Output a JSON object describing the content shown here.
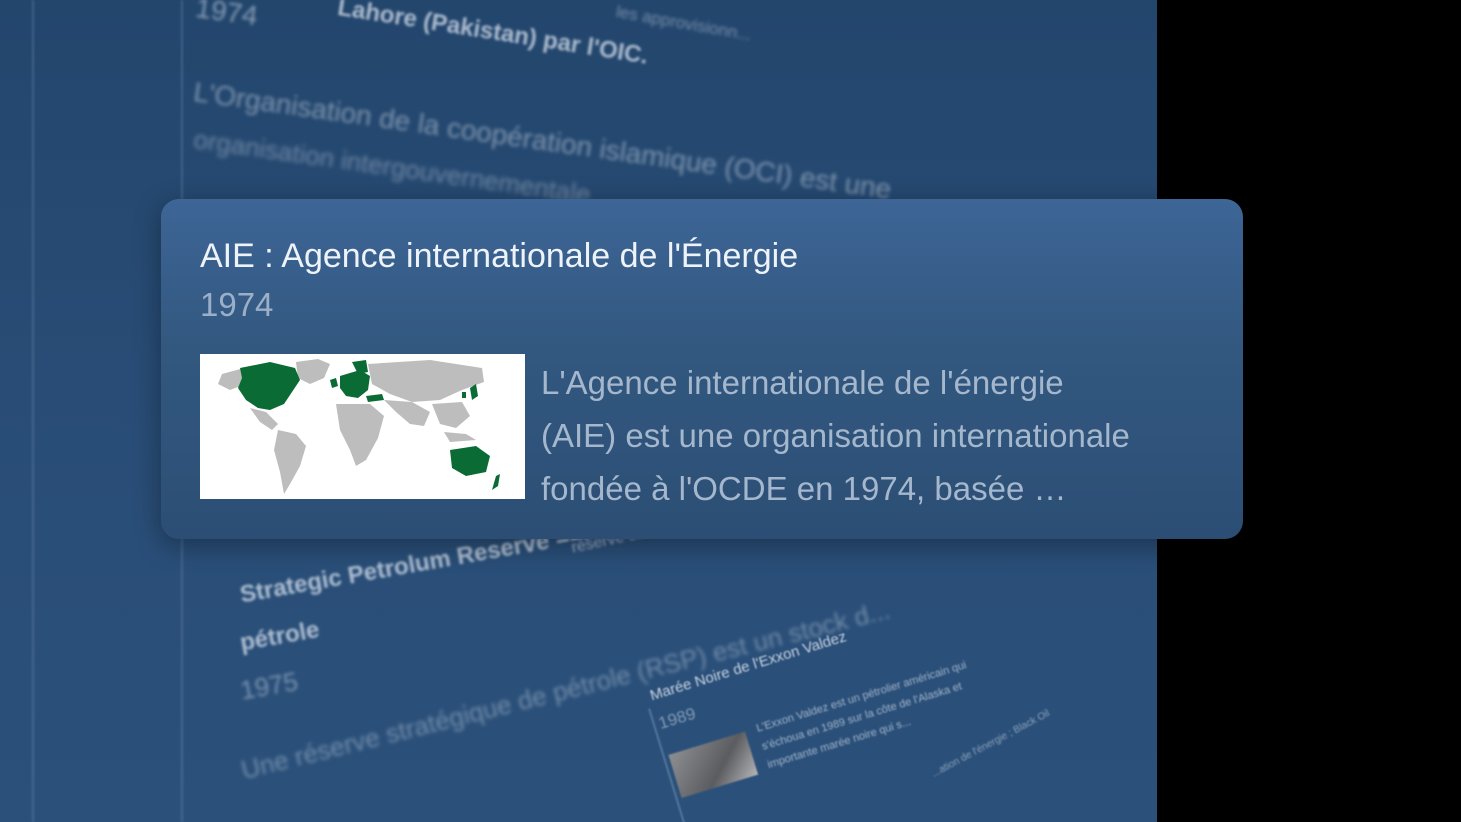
{
  "background": {
    "entries_top": {
      "year": "1974",
      "title_fragment": "Lahore (Pakistan) par l'OIC.",
      "text_fragment": "les approvisionn...",
      "desc_line1": "L'Organisation de la coopération islamique (OCI) est une",
      "desc_line2": "organisation intergouvernementale..."
    },
    "entry_spr": {
      "connector_text": "Strategic Petrolum Reserve ==> réserve stratégique de",
      "title_line1": "Strategic Petrolum Reserve ==> réserve stratégique de",
      "title_line2": "pétrole",
      "year": "1975",
      "description": "Une réserve stratégique de pétrole (RSP) est un stock d..."
    },
    "entry_exxon": {
      "title": "Marée Noire de l'Exxon Valdez",
      "year": "1989",
      "desc_line1": "L'Exxon Valdez est un pétrolier américain qui",
      "desc_line2": "s'échoua en 1989 sur la côte de l'Alaska et",
      "desc_line3": "importante marée noire qui s..."
    },
    "entry_far": {
      "fragment": "...ation de l'énergie ; Black Oil"
    }
  },
  "card": {
    "title": "AIE : Agence internationale de l'Énergie",
    "year": "1974",
    "thumbnail_icon": "world-map-iea-members",
    "description_lines": [
      "L'Agence internationale de l'énergie",
      "(AIE) est une organisation internationale",
      "fondée à l'OCDE en 1974, basée …"
    ]
  },
  "colors": {
    "map_member": "#0b6b34",
    "map_land": "#bdbdbd",
    "card_bg": "#34597f"
  }
}
